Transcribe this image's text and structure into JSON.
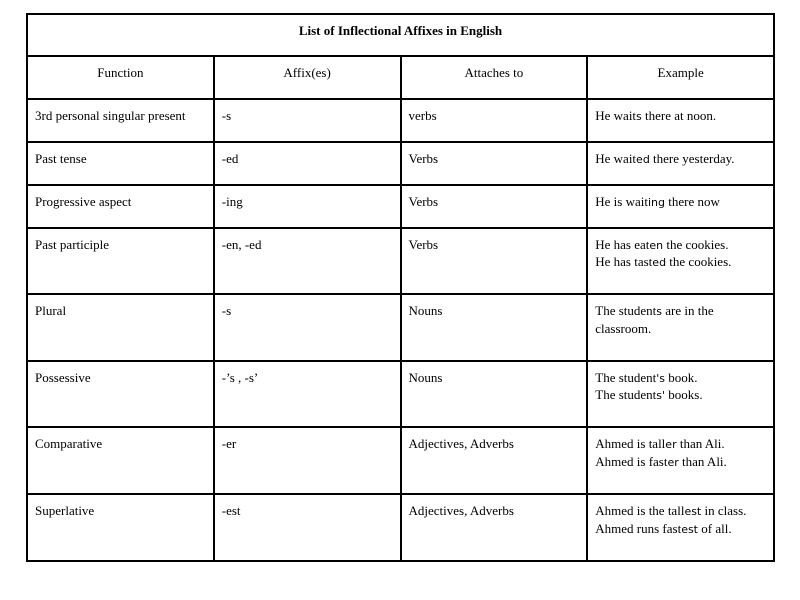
{
  "table": {
    "title": "List of Inflectional Affixes in English",
    "columns": [
      {
        "key": "function",
        "label": "Function"
      },
      {
        "key": "affix",
        "label": "Affix(es)"
      },
      {
        "key": "attaches",
        "label": "Attaches to"
      },
      {
        "key": "example",
        "label": "Example"
      }
    ],
    "header_fill": "#c0c0c0",
    "border_color": "#000000",
    "rows": [
      {
        "function": "3rd personal singular present",
        "affix": "-s",
        "attaches": "verbs",
        "example_lines": [
          {
            "pre": "He wait",
            "morph": "s",
            "post": " there at noon."
          }
        ]
      },
      {
        "function": "Past tense",
        "affix": "-ed",
        "attaches": "Verbs",
        "example_lines": [
          {
            "pre": "He wait",
            "morph": "ed",
            "post": " there yesterday."
          }
        ]
      },
      {
        "function": "Progressive aspect",
        "affix": "-ing",
        "attaches": "Verbs",
        "example_lines": [
          {
            "pre": "He is wait",
            "morph": "ing",
            "post": " there now"
          }
        ]
      },
      {
        "function": "Past participle",
        "affix": "-en, -ed",
        "attaches": "Verbs",
        "example_lines": [
          {
            "pre": "He has eat",
            "morph": "en",
            "post": " the cookies."
          },
          {
            "pre": "He has tast",
            "morph": "ed",
            "post": " the cookies."
          }
        ]
      },
      {
        "function": "Plural",
        "affix": "-s",
        "attaches": "Nouns",
        "example_lines": [
          {
            "pre": "The student",
            "morph": "s",
            "post": " are in the classroom."
          }
        ]
      },
      {
        "function": "Possessive",
        "affix": "-’s , -s’",
        "attaches": "Nouns",
        "example_lines": [
          {
            "pre": "The student",
            "morph": "'s",
            "post": " book."
          },
          {
            "pre": "The student",
            "morph": "s'",
            "post": " books."
          }
        ]
      },
      {
        "function": "Comparative",
        "affix": "-er",
        "attaches": "Adjectives, Adverbs",
        "example_lines": [
          {
            "pre": "Ahmed is tall",
            "morph": "er",
            "post": " than Ali."
          },
          {
            "pre": "Ahmed is fast",
            "morph": "er",
            "post": " than Ali."
          }
        ]
      },
      {
        "function": "Superlative",
        "affix": "-est",
        "attaches": "Adjectives, Adverbs",
        "example_lines": [
          {
            "pre": "Ahmed is the tall",
            "morph": "est",
            "post": " in class."
          },
          {
            "pre": "Ahmed runs fast",
            "morph": "est",
            "post": " of all."
          }
        ]
      }
    ]
  }
}
